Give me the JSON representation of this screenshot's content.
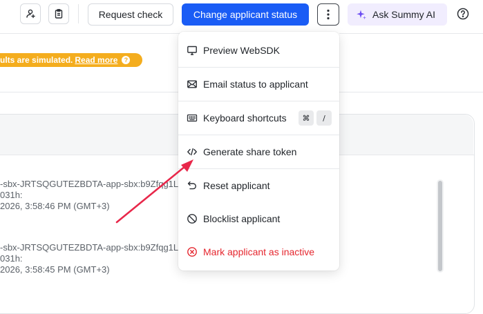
{
  "toolbar": {
    "request_check_label": "Request check",
    "change_status_label": "Change applicant status",
    "ask_ai_label": "Ask Summy AI",
    "icons": [
      "link-user-icon",
      "clipboard-icon",
      "kebab-icon",
      "sparkle-icon",
      "help-icon"
    ]
  },
  "banner": {
    "text": "ults are simulated.",
    "link": "Read more",
    "help": "?"
  },
  "logs": [
    {
      "line1": "-sbx-JRTSQGUTEZBDTA-app-sbx:b9Zfqg1L",
      "line2": "031h:",
      "time": "2026, 3:58:46 PM (GMT+3)"
    },
    {
      "line1": "-sbx-JRTSQGUTEZBDTA-app-sbx:b9Zfqg1L",
      "line2": "031h:",
      "time": "2026, 3:58:45 PM (GMT+3)"
    }
  ],
  "menu": {
    "items": [
      {
        "label": "Preview WebSDK",
        "icon": "monitor-icon"
      },
      {
        "label": "Email status to applicant",
        "icon": "mail-icon"
      },
      {
        "label": "Keyboard shortcuts",
        "icon": "keyboard-icon",
        "keys": [
          "⌘",
          "/"
        ]
      },
      {
        "label": "Generate share token",
        "icon": "code-icon"
      },
      {
        "label": "Reset applicant",
        "icon": "undo-icon"
      },
      {
        "label": "Blocklist applicant",
        "icon": "ban-icon"
      },
      {
        "label": "Mark applicant as inactive",
        "icon": "circle-x-icon"
      }
    ]
  },
  "colors": {
    "primary": "#1a5cf5",
    "banner": "#f4ad1e",
    "danger": "#e5262e",
    "ai_bg": "#f1edfe",
    "annotation_arrow": "#e8274a"
  }
}
